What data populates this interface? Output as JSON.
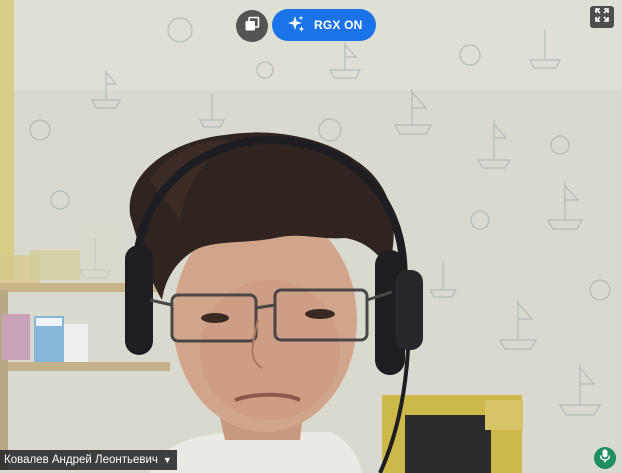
{
  "participant": {
    "name": "Ковалев Андрей Леонтьевич",
    "name_menu_icon": "chevron-down-icon"
  },
  "toolbar": {
    "pip_icon": "picture-in-picture-icon",
    "rgx_label": "RGX ON",
    "rgx_icon": "sparkle-icon",
    "expand_icon": "fullscreen-icon",
    "mic_icon": "microphone-icon"
  },
  "colors": {
    "rgx_accent": "#1a73e8",
    "mic_accent": "#1e8e5e",
    "wall": "#dcdcd2"
  }
}
